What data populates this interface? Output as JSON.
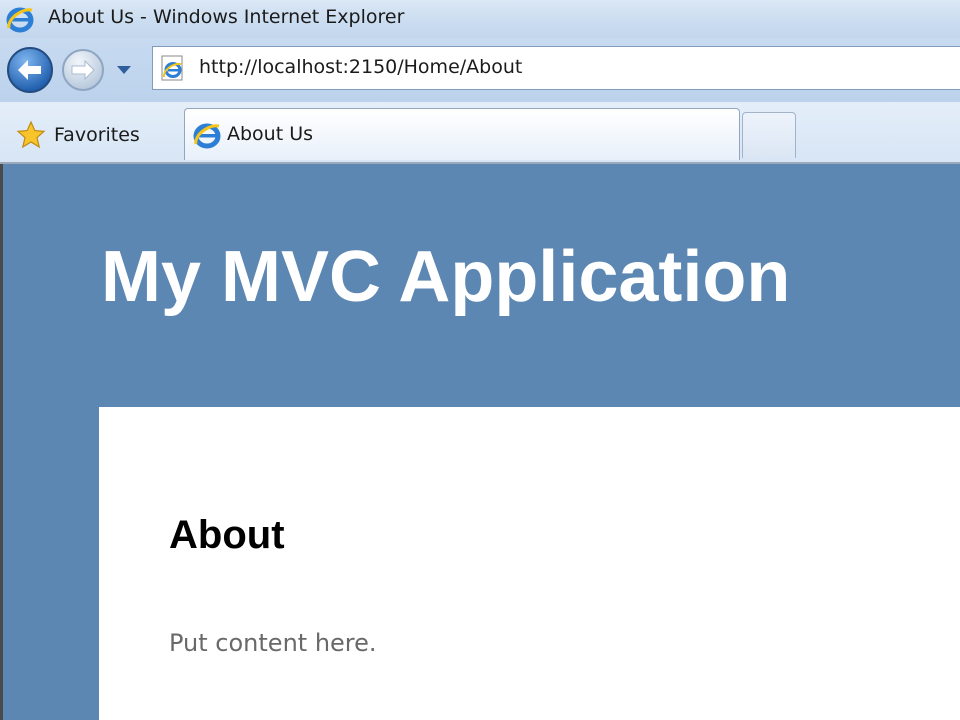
{
  "window": {
    "title": "About Us - Windows Internet Explorer"
  },
  "navigation": {
    "url": "http://localhost:2150/Home/About",
    "back_icon": "back-arrow-icon",
    "forward_icon": "forward-arrow-icon",
    "history_icon": "chevron-down-icon"
  },
  "favorites_bar": {
    "favorites_label": "Favorites",
    "favorites_icon": "star-icon"
  },
  "tabs": [
    {
      "label": "About Us",
      "icon": "ie-icon",
      "active": true
    },
    {
      "label": "",
      "icon": "new-tab",
      "active": false
    }
  ],
  "page": {
    "site_title": "My MVC Application",
    "heading": "About",
    "body_text": "Put content here.",
    "header_bg_color": "#5c87b2",
    "content_bg_color": "#ffffff"
  }
}
